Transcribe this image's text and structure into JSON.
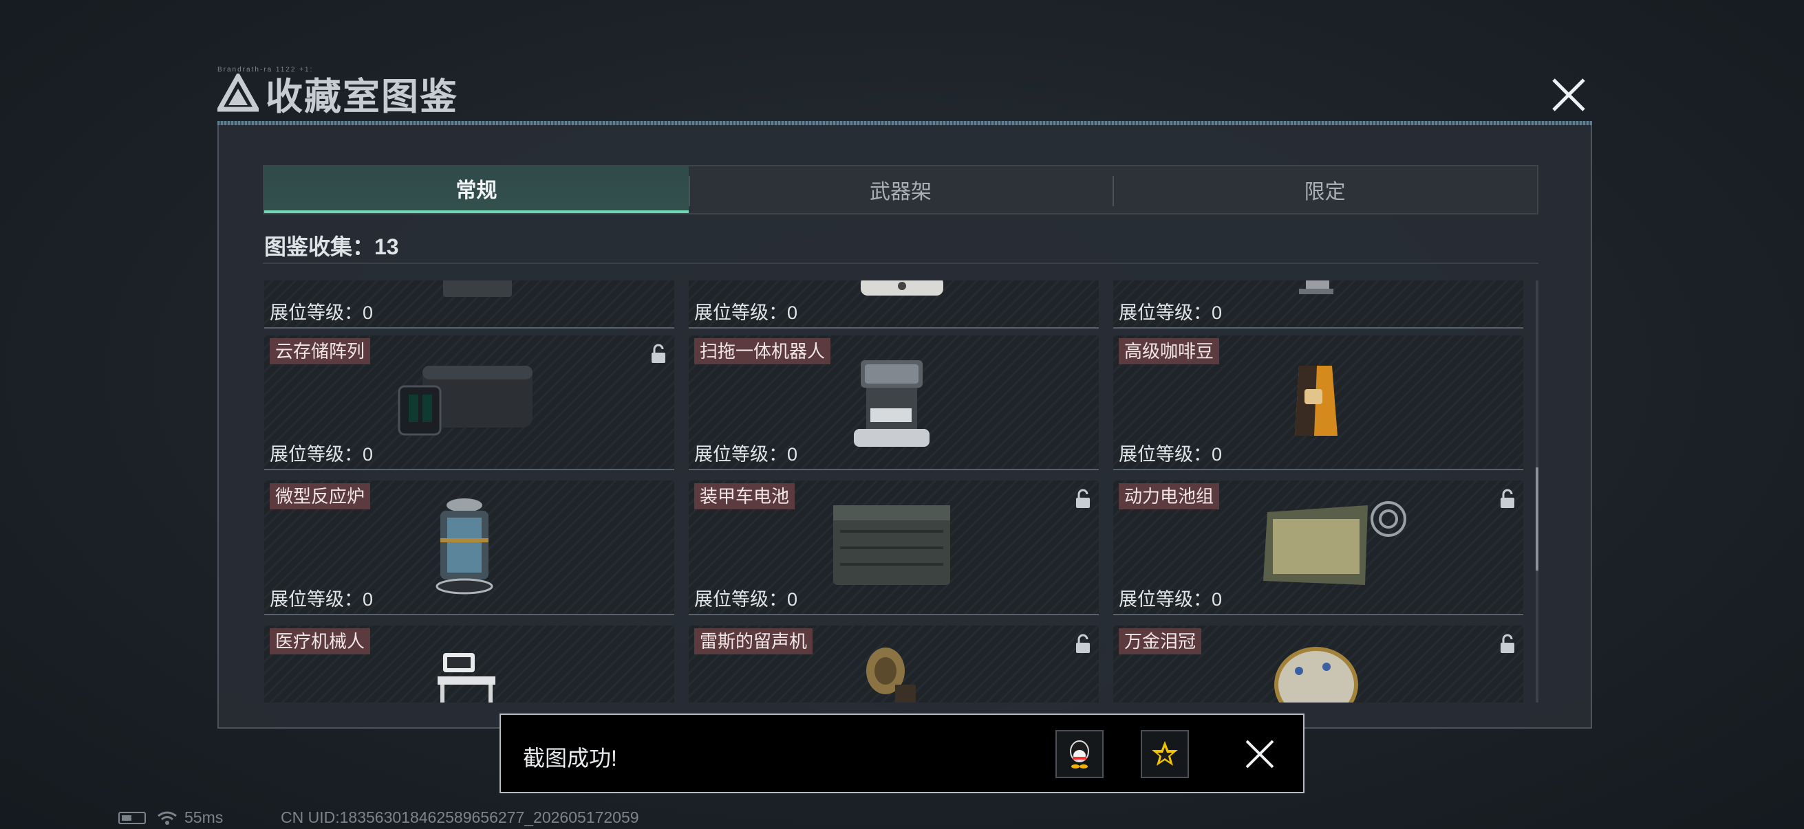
{
  "window": {
    "title": "收藏室图鉴",
    "title_tiny": "Brandrath-ra 1122 +1:"
  },
  "tabs": [
    {
      "label": "常规",
      "active": true
    },
    {
      "label": "武器架",
      "active": false
    },
    {
      "label": "限定",
      "active": false
    }
  ],
  "collection": {
    "label": "图鉴收集：13"
  },
  "level_label": "展位等级：0",
  "cards": [
    {
      "name": "",
      "locked": false,
      "icon": "device-partial-icon"
    },
    {
      "name": "",
      "locked": false,
      "icon": "machine-partial-icon"
    },
    {
      "name": "",
      "locked": false,
      "icon": "gadget-partial-icon"
    },
    {
      "name": "云存储阵列",
      "locked": true,
      "icon": "storage-array-icon"
    },
    {
      "name": "扫拖一体机器人",
      "locked": false,
      "icon": "mop-robot-icon"
    },
    {
      "name": "高级咖啡豆",
      "locked": false,
      "icon": "coffee-bag-icon"
    },
    {
      "name": "微型反应炉",
      "locked": false,
      "icon": "reactor-icon"
    },
    {
      "name": "装甲车电池",
      "locked": true,
      "icon": "vehicle-battery-icon"
    },
    {
      "name": "动力电池组",
      "locked": true,
      "icon": "battery-pack-icon"
    },
    {
      "name": "医疗机械人",
      "locked": false,
      "icon": "medical-robot-icon"
    },
    {
      "name": "雷斯的留声机",
      "locked": true,
      "icon": "gramophone-icon"
    },
    {
      "name": "万金泪冠",
      "locked": true,
      "icon": "jeweled-crown-icon"
    }
  ],
  "toast": {
    "message": "截图成功!",
    "buttons": [
      "qq-share-icon",
      "favorite-star-icon"
    ]
  },
  "status_bar": {
    "ping": "55ms",
    "uid": "CN UID:18356301846258965627​7_202605172059"
  },
  "colors": {
    "accent_green": "#6fd6b2",
    "name_tag_bg": "#5b3b3e",
    "panel_bg": "#282e35"
  }
}
